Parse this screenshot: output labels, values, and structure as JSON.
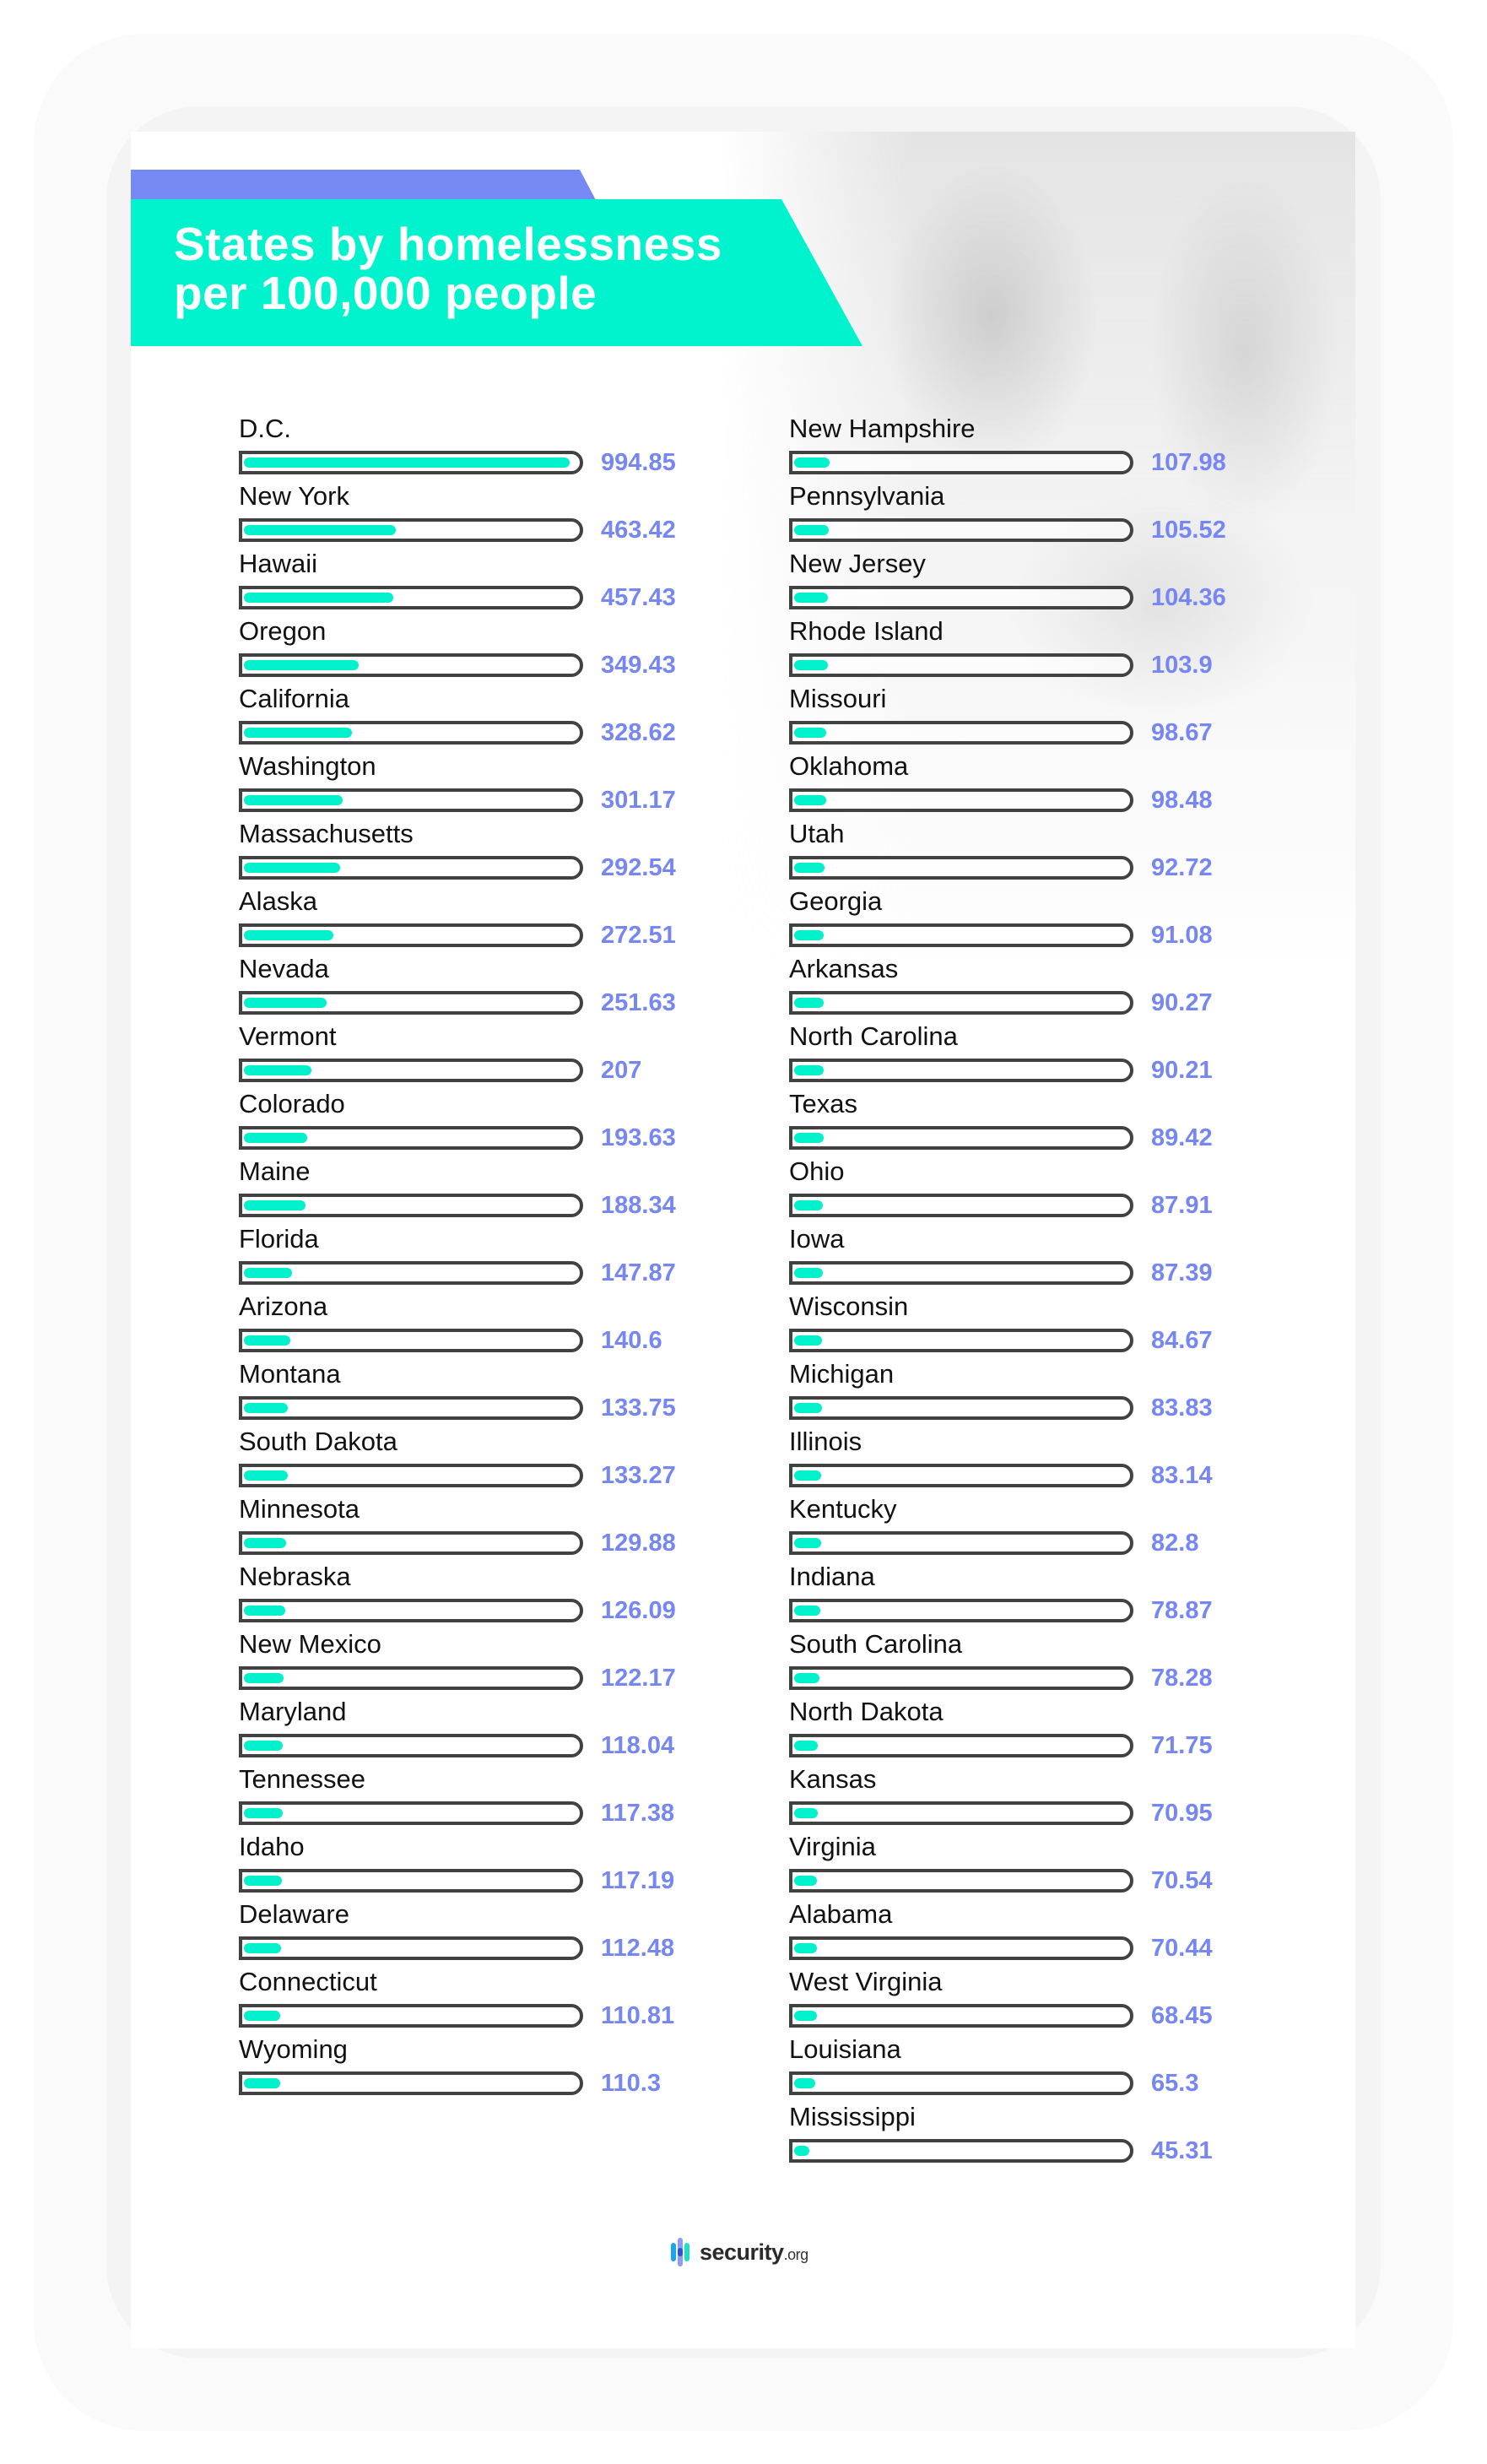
{
  "title": {
    "line1": "States by homelessness",
    "line2": "per 100,000 people"
  },
  "colors": {
    "title_band": "#00f3cd",
    "accent_band": "#7689f5",
    "bar_fill": "#00f1cc",
    "bar_outline": "#424242",
    "value_text": "#7686f2"
  },
  "footer": {
    "brand": "security",
    "brand_suffix": ".org",
    "logo_icon": "security-org-bars-icon"
  },
  "chart_data": {
    "type": "bar",
    "orientation": "horizontal",
    "title": "States by homelessness per 100,000 people",
    "xlabel": "",
    "ylabel": "",
    "max_value": 994.85,
    "grid": false,
    "legend": "none",
    "columns": [
      {
        "items": [
          {
            "state": "D.C.",
            "value": 994.85,
            "label": "994.85"
          },
          {
            "state": "New York",
            "value": 463.42,
            "label": "463.42"
          },
          {
            "state": "Hawaii",
            "value": 457.43,
            "label": "457.43"
          },
          {
            "state": "Oregon",
            "value": 349.43,
            "label": "349.43"
          },
          {
            "state": "California",
            "value": 328.62,
            "label": "328.62"
          },
          {
            "state": "Washington",
            "value": 301.17,
            "label": "301.17"
          },
          {
            "state": "Massachusetts",
            "value": 292.54,
            "label": "292.54"
          },
          {
            "state": "Alaska",
            "value": 272.51,
            "label": "272.51"
          },
          {
            "state": "Nevada",
            "value": 251.63,
            "label": "251.63"
          },
          {
            "state": "Vermont",
            "value": 207,
            "label": "207"
          },
          {
            "state": "Colorado",
            "value": 193.63,
            "label": "193.63"
          },
          {
            "state": "Maine",
            "value": 188.34,
            "label": "188.34"
          },
          {
            "state": "Florida",
            "value": 147.87,
            "label": "147.87"
          },
          {
            "state": "Arizona",
            "value": 140.6,
            "label": "140.6"
          },
          {
            "state": "Montana",
            "value": 133.75,
            "label": "133.75"
          },
          {
            "state": "South Dakota",
            "value": 133.27,
            "label": "133.27"
          },
          {
            "state": "Minnesota",
            "value": 129.88,
            "label": "129.88"
          },
          {
            "state": "Nebraska",
            "value": 126.09,
            "label": "126.09"
          },
          {
            "state": "New Mexico",
            "value": 122.17,
            "label": "122.17"
          },
          {
            "state": "Maryland",
            "value": 118.04,
            "label": "118.04"
          },
          {
            "state": "Tennessee",
            "value": 117.38,
            "label": "117.38"
          },
          {
            "state": "Idaho",
            "value": 117.19,
            "label": "117.19"
          },
          {
            "state": "Delaware",
            "value": 112.48,
            "label": "112.48"
          },
          {
            "state": "Connecticut",
            "value": 110.81,
            "label": "110.81"
          },
          {
            "state": "Wyoming",
            "value": 110.3,
            "label": "110.3"
          }
        ]
      },
      {
        "items": [
          {
            "state": "New Hampshire",
            "value": 107.98,
            "label": "107.98"
          },
          {
            "state": "Pennsylvania",
            "value": 105.52,
            "label": "105.52"
          },
          {
            "state": "New Jersey",
            "value": 104.36,
            "label": "104.36"
          },
          {
            "state": "Rhode Island",
            "value": 103.9,
            "label": "103.9"
          },
          {
            "state": "Missouri",
            "value": 98.67,
            "label": "98.67"
          },
          {
            "state": "Oklahoma",
            "value": 98.48,
            "label": "98.48"
          },
          {
            "state": "Utah",
            "value": 92.72,
            "label": "92.72"
          },
          {
            "state": "Georgia",
            "value": 91.08,
            "label": "91.08"
          },
          {
            "state": "Arkansas",
            "value": 90.27,
            "label": "90.27"
          },
          {
            "state": "North Carolina",
            "value": 90.21,
            "label": "90.21"
          },
          {
            "state": "Texas",
            "value": 89.42,
            "label": "89.42"
          },
          {
            "state": "Ohio",
            "value": 87.91,
            "label": "87.91"
          },
          {
            "state": "Iowa",
            "value": 87.39,
            "label": "87.39"
          },
          {
            "state": "Wisconsin",
            "value": 84.67,
            "label": "84.67"
          },
          {
            "state": "Michigan",
            "value": 83.83,
            "label": "83.83"
          },
          {
            "state": "Illinois",
            "value": 83.14,
            "label": "83.14"
          },
          {
            "state": "Kentucky",
            "value": 82.8,
            "label": "82.8"
          },
          {
            "state": "Indiana",
            "value": 78.87,
            "label": "78.87"
          },
          {
            "state": "South Carolina",
            "value": 78.28,
            "label": "78.28"
          },
          {
            "state": "North Dakota",
            "value": 71.75,
            "label": "71.75"
          },
          {
            "state": "Kansas",
            "value": 70.95,
            "label": "70.95"
          },
          {
            "state": "Virginia",
            "value": 70.54,
            "label": "70.54"
          },
          {
            "state": "Alabama",
            "value": 70.44,
            "label": "70.44"
          },
          {
            "state": "West Virginia",
            "value": 68.45,
            "label": "68.45"
          },
          {
            "state": "Louisiana",
            "value": 65.3,
            "label": "65.3"
          },
          {
            "state": "Mississippi",
            "value": 45.31,
            "label": "45.31"
          }
        ]
      }
    ]
  }
}
